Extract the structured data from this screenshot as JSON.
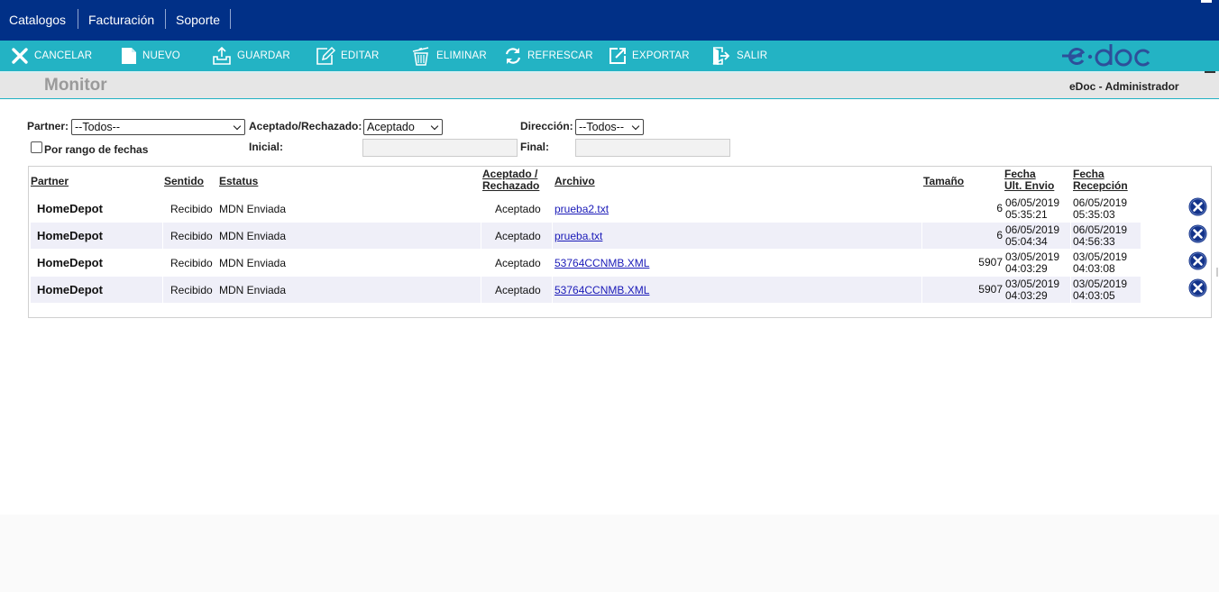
{
  "topnav": {
    "items": [
      "Catalogos",
      "Facturación",
      "Soporte"
    ]
  },
  "toolbar": {
    "buttons": [
      {
        "label": "CANCELAR",
        "icon": "close-icon"
      },
      {
        "label": "NUEVO",
        "icon": "new-document-icon"
      },
      {
        "label": "GUARDAR",
        "icon": "save-icon"
      },
      {
        "label": "EDITAR",
        "icon": "edit-icon"
      },
      {
        "label": "ELIMINAR",
        "icon": "trash-icon"
      },
      {
        "label": "REFRESCAR",
        "icon": "refresh-icon"
      },
      {
        "label": "EXPORTAR",
        "icon": "export-icon"
      },
      {
        "label": "SALIR",
        "icon": "exit-icon"
      }
    ],
    "logo_text": "e·doc"
  },
  "titlebar": {
    "title": "Monitor",
    "user": "eDoc - Administrador"
  },
  "filters": {
    "partner_label": "Partner:",
    "partner_value": "--Todos--",
    "aceptado_label": "Aceptado/Rechazado:",
    "aceptado_value": "Aceptado",
    "direccion_label": "Dirección:",
    "direccion_value": "--Todos--",
    "rango_label": "Por rango de fechas",
    "inicial_label": "Inicial:",
    "final_label": "Final:"
  },
  "table": {
    "headers": {
      "partner": "Partner",
      "sentido": "Sentido",
      "estatus": "Estatus",
      "aceptado_1": "Aceptado /",
      "aceptado_2": "Rechazado",
      "archivo": "Archivo",
      "tamano": "Tamaño",
      "fecha_envio_1": "Fecha",
      "fecha_envio_2": "Ult. Envio",
      "fecha_recep_1": "Fecha",
      "fecha_recep_2": "Recepción"
    },
    "rows": [
      {
        "partner": "HomeDepot",
        "sentido": "Recibido",
        "estatus": "MDN Enviada",
        "aceptado": "Aceptado",
        "archivo": "prueba2.txt",
        "tamano": "6",
        "envio_fecha": "06/05/2019",
        "envio_hora": "05:35:21",
        "recep_fecha": "06/05/2019",
        "recep_hora": "05:35:03"
      },
      {
        "partner": "HomeDepot",
        "sentido": "Recibido",
        "estatus": "MDN Enviada",
        "aceptado": "Aceptado",
        "archivo": "prueba.txt",
        "tamano": "6",
        "envio_fecha": "06/05/2019",
        "envio_hora": "05:04:34",
        "recep_fecha": "06/05/2019",
        "recep_hora": "04:56:33"
      },
      {
        "partner": "HomeDepot",
        "sentido": "Recibido",
        "estatus": "MDN Enviada",
        "aceptado": "Aceptado",
        "archivo": "53764CCNMB.XML",
        "tamano": "5907",
        "envio_fecha": "03/05/2019",
        "envio_hora": "04:03:29",
        "recep_fecha": "03/05/2019",
        "recep_hora": "04:03:08"
      },
      {
        "partner": "HomeDepot",
        "sentido": "Recibido",
        "estatus": "MDN Enviada",
        "aceptado": "Aceptado",
        "archivo": "53764CCNMB.XML",
        "tamano": "5907",
        "envio_fecha": "03/05/2019",
        "envio_hora": "04:03:29",
        "recep_fecha": "03/05/2019",
        "recep_hora": "04:03:05"
      }
    ]
  },
  "colors": {
    "topnav_bg": "#013087",
    "toolbar_bg": "#23b3c4",
    "logo_color": "#2d4f9a",
    "delete_icon": "#13338a",
    "link": "#1a1ab8"
  }
}
